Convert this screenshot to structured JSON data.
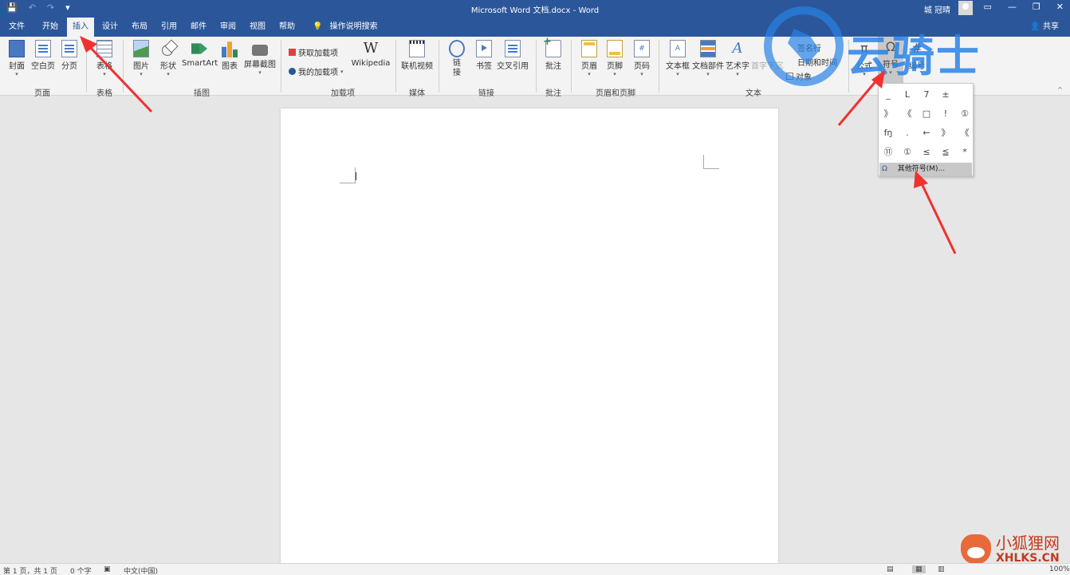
{
  "titlebar": {
    "title": "Microsoft Word 文档.docx  -  Word",
    "user": "城 冠晴",
    "qat": [
      "💾",
      "↶",
      "↷",
      "▾"
    ],
    "window_buttons": [
      "▭",
      "—",
      "❐",
      "✕"
    ]
  },
  "tabs": [
    {
      "label": "文件"
    },
    {
      "label": "开始"
    },
    {
      "label": "插入"
    },
    {
      "label": "设计"
    },
    {
      "label": "布局"
    },
    {
      "label": "引用"
    },
    {
      "label": "邮件"
    },
    {
      "label": "审阅"
    },
    {
      "label": "视图"
    },
    {
      "label": "帮助"
    }
  ],
  "tell_me": "操作说明搜索",
  "share": "共享",
  "ribbon": {
    "buttons": {
      "cover": "封面",
      "blank": "空白页",
      "break": "分页",
      "table": "表格",
      "picture": "图片",
      "shape": "形状",
      "smartart": "SmartArt",
      "chart": "图表",
      "screenshot": "屏幕截图",
      "get_addins": "获取加载项",
      "my_addins": "我的加载项",
      "wikipedia": "Wikipedia",
      "online_video": "联机视频",
      "link": "链接",
      "bookmark": "书签",
      "crossref": "交叉引用",
      "comment": "批注",
      "header": "页眉",
      "footer": "页脚",
      "page_number": "页码",
      "textbox": "文本框",
      "quickparts": "文档部件",
      "wordart": "艺术字",
      "dropcap": "首字下沉",
      "signature": "签名行",
      "datetime": "日期和时间",
      "object": "对象",
      "equation": "公式",
      "symbol": "符号",
      "number": "编号"
    },
    "groups": {
      "pages": "页面",
      "tables": "表格",
      "illustrations": "插图",
      "addins": "加载项",
      "media": "媒体",
      "links": "链接",
      "comments": "批注",
      "header_footer": "页眉和页脚",
      "text": "文本"
    }
  },
  "symbol_dropdown": {
    "symbols": [
      "_",
      "L",
      "7",
      "±",
      "",
      "》",
      "《",
      "□",
      "!",
      "①",
      "fŋ",
      ".",
      "←",
      "》",
      "《",
      "⑪",
      "①",
      "≤",
      "≦",
      "*"
    ],
    "more": "其他符号(M)..."
  },
  "statusbar": {
    "page": "第 1 页，共 1 页",
    "words": "0 个字",
    "lang": "中文(中国)",
    "zoom": "100%"
  },
  "watermark": {
    "logo_text": "云骑士",
    "bottom_cn": "小狐狸网",
    "bottom_en": "XHLKS.CN"
  }
}
